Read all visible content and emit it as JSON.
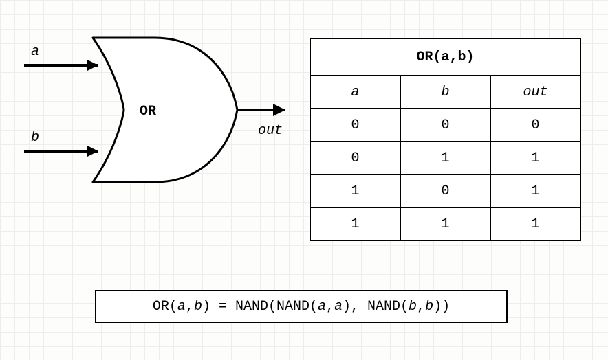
{
  "gate": {
    "name": "OR",
    "input_a": "a",
    "input_b": "b",
    "output": "out"
  },
  "truth_table": {
    "title": "OR(a,b)",
    "headers": {
      "a": "a",
      "b": "b",
      "out": "out"
    },
    "rows": [
      {
        "a": "0",
        "b": "0",
        "out": "0"
      },
      {
        "a": "0",
        "b": "1",
        "out": "1"
      },
      {
        "a": "1",
        "b": "0",
        "out": "1"
      },
      {
        "a": "1",
        "b": "1",
        "out": "1"
      }
    ]
  },
  "formula": {
    "p1": "OR(",
    "p2": "a",
    "p3": ",",
    "p4": "b",
    "p5": ") = NAND(NAND(",
    "p6": "a",
    "p7": ",",
    "p8": "a",
    "p9": "), NAND(",
    "p10": "b",
    "p11": ",",
    "p12": "b",
    "p13": "))"
  },
  "chart_data": {
    "type": "table",
    "title": "OR(a,b)",
    "gate": "OR",
    "equation": "OR(a,b) = NAND(NAND(a,a), NAND(b,b))",
    "columns": [
      "a",
      "b",
      "out"
    ],
    "rows": [
      [
        0,
        0,
        0
      ],
      [
        0,
        1,
        1
      ],
      [
        1,
        0,
        1
      ],
      [
        1,
        1,
        1
      ]
    ]
  }
}
